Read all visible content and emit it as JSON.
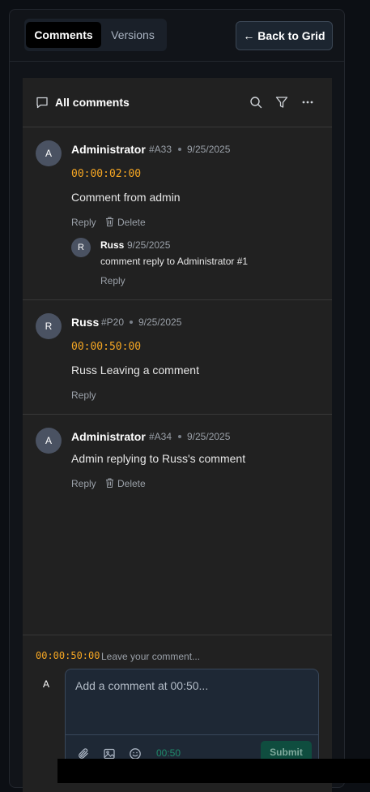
{
  "tabs": [
    {
      "label": "Comments",
      "active": true
    },
    {
      "label": "Versions",
      "active": false
    }
  ],
  "back_button": "← Back to Grid",
  "panel": {
    "title": "All comments",
    "icons": [
      "comment-icon",
      "search-icon",
      "filter-icon",
      "more-icon"
    ]
  },
  "comments": [
    {
      "initial": "A",
      "author": "Administrator",
      "id": "#A33",
      "date": "9/25/2025",
      "timecode": "00:00:02:00",
      "text": "Comment from admin",
      "reply_label": "Reply",
      "delete_label": "Delete",
      "replies": [
        {
          "initial": "R",
          "author": "Russ",
          "date": "9/25/2025",
          "text": "comment reply to Administrator #1",
          "reply_label": "Reply"
        }
      ]
    },
    {
      "initial": "R",
      "author": "Russ",
      "id": "#P20",
      "date": "9/25/2025",
      "timecode": "00:00:50:00",
      "text": "Russ Leaving a comment",
      "reply_label": "Reply"
    },
    {
      "initial": "A",
      "author": "Administrator",
      "id": "#A34",
      "date": "9/25/2025",
      "text": "Admin replying to Russ's comment",
      "reply_label": "Reply",
      "delete_label": "Delete"
    }
  ],
  "composer": {
    "timecode": "00:00:50:00",
    "hint": "Leave your comment...",
    "avatar_initial": "A",
    "placeholder": "Add a comment at 00:50...",
    "time_badge": "00:50",
    "submit_label": "Submit",
    "icons": [
      "paperclip-icon",
      "image-icon",
      "emoji-icon"
    ]
  },
  "colors": {
    "accent_timecode": "#f5a623",
    "submit_bg": "#0f4d3f",
    "card_bg": "#212121",
    "page_bg": "#0c0f14"
  }
}
